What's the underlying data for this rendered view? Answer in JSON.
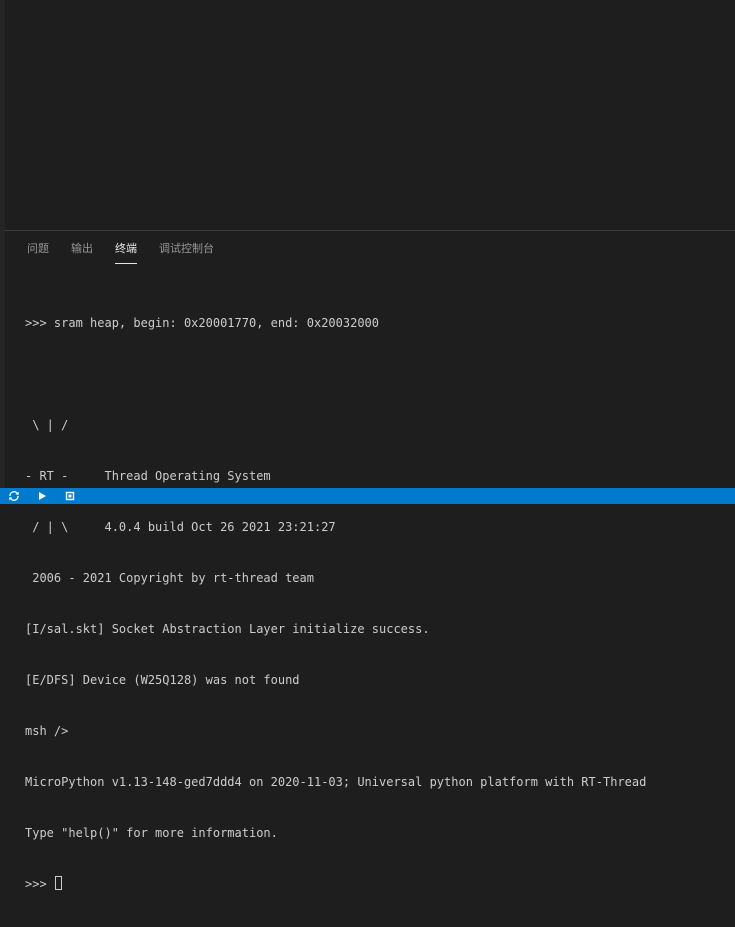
{
  "panel": {
    "tabs": [
      {
        "label": "问题"
      },
      {
        "label": "输出"
      },
      {
        "label": "终端"
      },
      {
        "label": "调试控制台"
      }
    ],
    "active_tab": "终端"
  },
  "terminal": {
    "lines": [
      ">>> sram heap, begin: 0x20001770, end: 0x20032000",
      "",
      " \\ | /",
      "- RT -     Thread Operating System",
      " / | \\     4.0.4 build Oct 26 2021 23:21:27",
      " 2006 - 2021 Copyright by rt-thread team",
      "[I/sal.skt] Socket Abstraction Layer initialize success.",
      "[E/DFS] Device (W25Q128) was not found",
      "msh />",
      "MicroPython v1.13-148-ged7ddd4 on 2020-11-03; Universal python platform with RT-Thread",
      "Type \"help()\" for more information.",
      ">>> "
    ]
  },
  "statusbar": {
    "icons": [
      "sync-icon",
      "run-icon",
      "stop-icon"
    ],
    "color": "#007acc"
  }
}
